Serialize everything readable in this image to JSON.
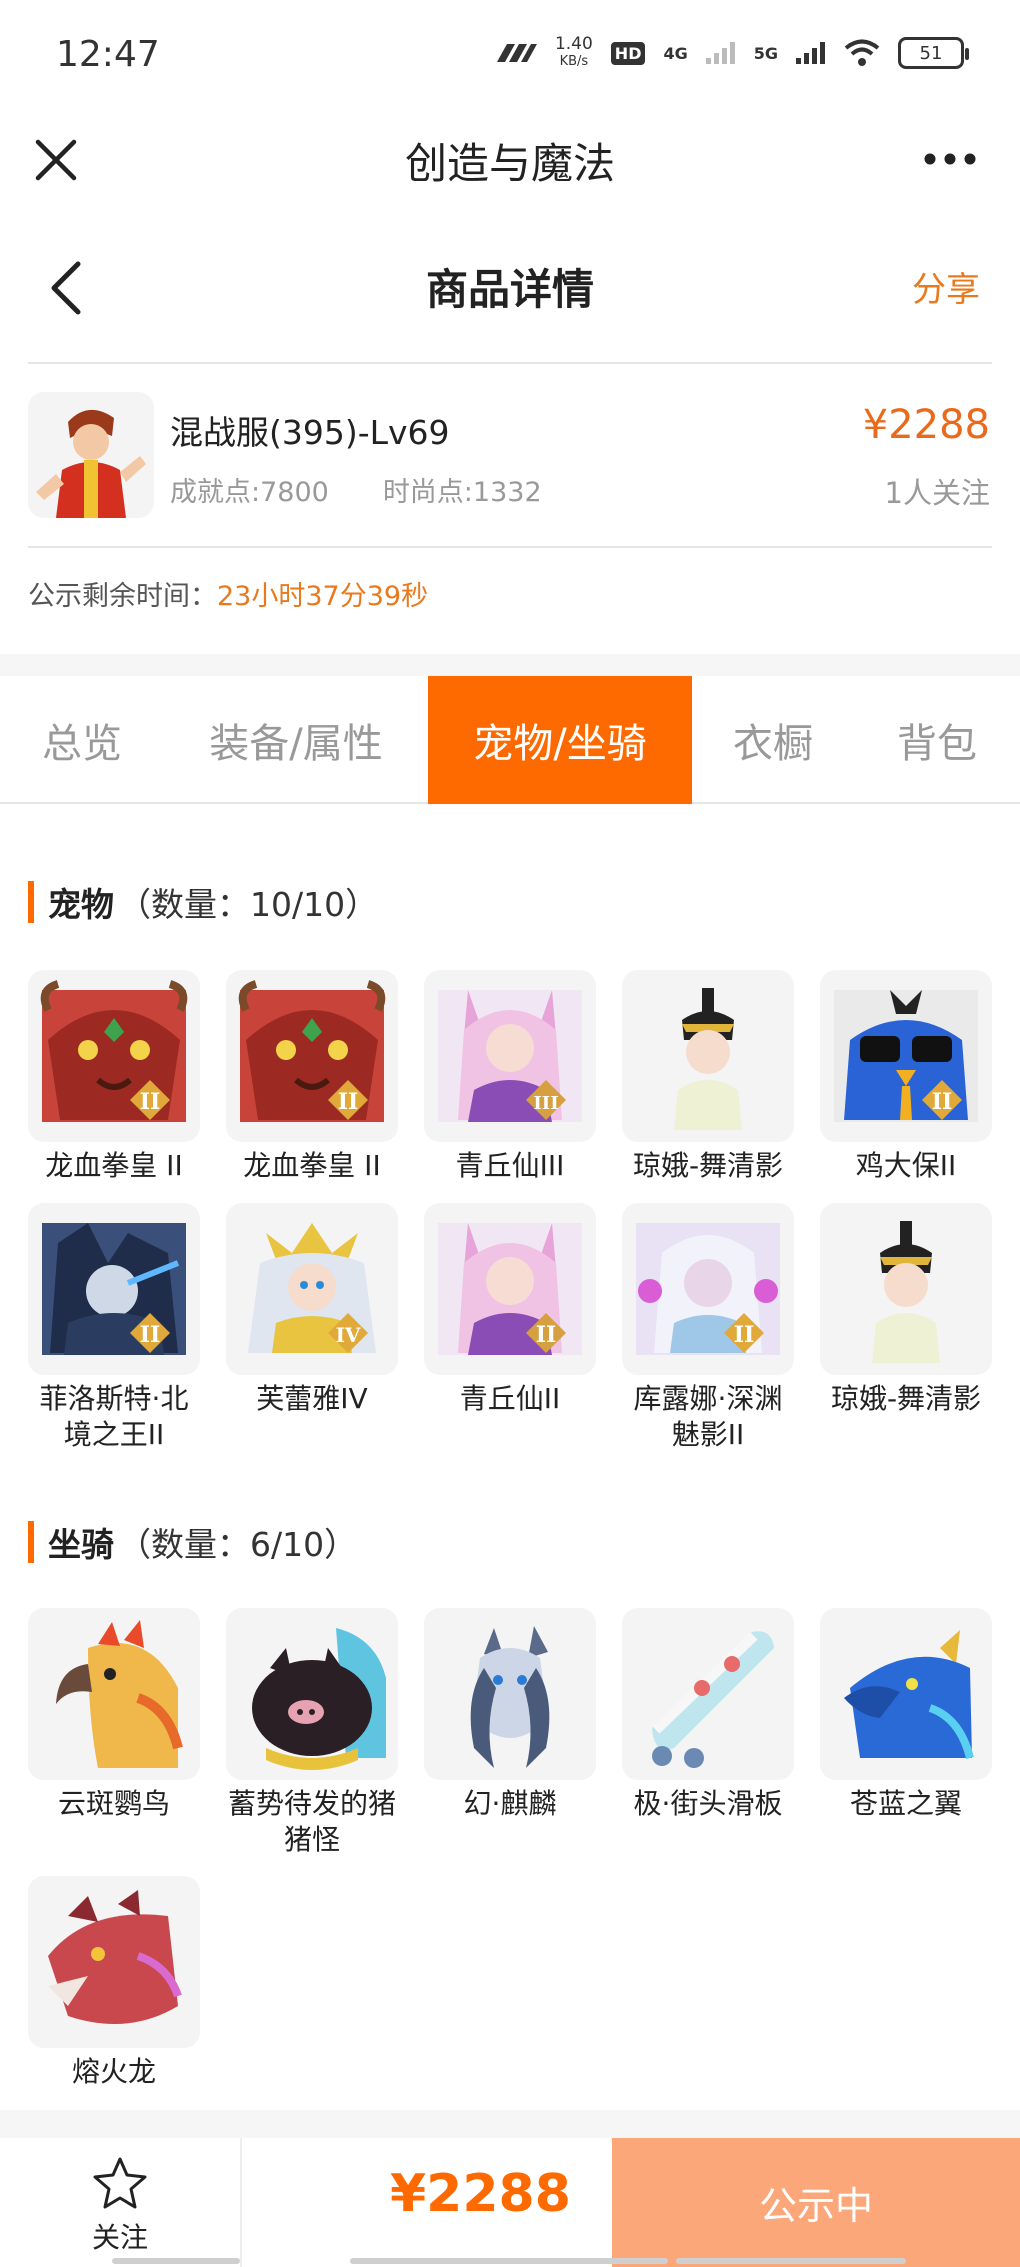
{
  "status_bar": {
    "time": "12:47",
    "net_speed_value": "1.40",
    "net_speed_unit": "KB/s",
    "hd": "HD",
    "network_1": "4G",
    "network_2": "5G",
    "battery": "51"
  },
  "app_bar": {
    "title": "创造与魔法"
  },
  "detail_header": {
    "title": "商品详情",
    "share": "分享"
  },
  "product": {
    "name": "混战服(395)-Lv69",
    "achievement": "成就点:7800",
    "fashion": "时尚点:1332",
    "price": "¥2288",
    "followers": "1人关注"
  },
  "publicity": {
    "label": "公示剩余时间：",
    "countdown": "23小时37分39秒"
  },
  "tabs": [
    {
      "label": "总览",
      "active": false
    },
    {
      "label": "装备/属性",
      "active": false
    },
    {
      "label": "宠物/坐骑",
      "active": true
    },
    {
      "label": "衣橱",
      "active": false
    },
    {
      "label": "背包",
      "active": false
    }
  ],
  "pets": {
    "title": "宠物",
    "count": "（数量：10/10）",
    "items": [
      {
        "label": "龙血拳皇 II",
        "icon": "red-dragon-icon",
        "rank": "II"
      },
      {
        "label": "龙血拳皇 II",
        "icon": "red-dragon-icon",
        "rank": "II"
      },
      {
        "label": "青丘仙III",
        "icon": "fox-fairy-icon",
        "rank": "III"
      },
      {
        "label": "琼娥-舞清影",
        "icon": "dancer-icon",
        "rank": ""
      },
      {
        "label": "鸡大保II",
        "icon": "blue-bird-icon",
        "rank": "II"
      },
      {
        "label": "菲洛斯特·北境之王II",
        "icon": "ice-king-icon",
        "rank": "II"
      },
      {
        "label": "芙蕾雅IV",
        "icon": "valkyrie-icon",
        "rank": "IV"
      },
      {
        "label": "青丘仙II",
        "icon": "fox-fairy-icon",
        "rank": "II"
      },
      {
        "label": "库露娜·深渊魅影II",
        "icon": "abyss-girl-icon",
        "rank": "II"
      },
      {
        "label": "琼娥-舞清影",
        "icon": "dancer-icon",
        "rank": ""
      }
    ]
  },
  "mounts": {
    "title": "坐骑",
    "count": "（数量：6/10）",
    "items": [
      {
        "label": "云斑鹦鸟",
        "icon": "parrot-icon"
      },
      {
        "label": "蓄势待发的猪猪怪",
        "icon": "pig-icon"
      },
      {
        "label": "幻·麒麟",
        "icon": "qilin-icon"
      },
      {
        "label": "极·街头滑板",
        "icon": "skateboard-icon"
      },
      {
        "label": "苍蓝之翼",
        "icon": "blue-dragon-icon"
      },
      {
        "label": "熔火龙",
        "icon": "lava-dragon-icon"
      }
    ]
  },
  "bottom_bar": {
    "follow": "关注",
    "price": "¥2288",
    "status": "公示中"
  },
  "colors": {
    "accent": "#ff6a00",
    "price": "#ea6a1c",
    "status_button": "#fca77a"
  }
}
